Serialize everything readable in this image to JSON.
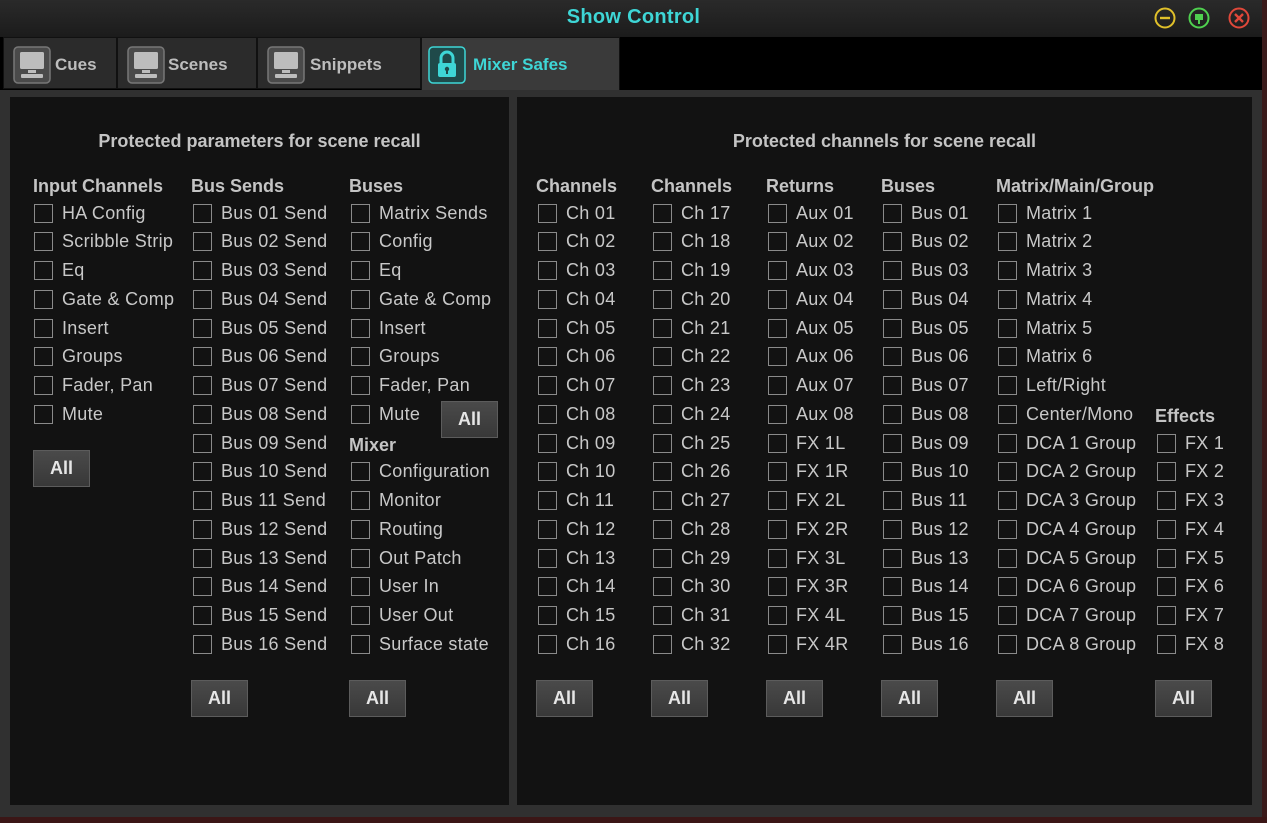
{
  "window": {
    "title": "Show Control"
  },
  "tabs": [
    {
      "label": "Cues",
      "icon": "monitor-icon"
    },
    {
      "label": "Scenes",
      "icon": "monitor-icon"
    },
    {
      "label": "Snippets",
      "icon": "monitor-icon"
    },
    {
      "label": "Mixer Safes",
      "icon": "lock-icon"
    }
  ],
  "accent_color": "#3ed6d6",
  "left_panel": {
    "title": "Protected parameters for scene recall",
    "input_channels": {
      "heading": "Input Channels",
      "items": [
        "HA Config",
        "Scribble Strip",
        "Eq",
        "Gate & Comp",
        "Insert",
        "Groups",
        "Fader, Pan",
        "Mute"
      ],
      "all_label": "All"
    },
    "bus_sends": {
      "heading": "Bus Sends",
      "items": [
        "Bus 01 Send",
        "Bus 02 Send",
        "Bus 03 Send",
        "Bus 04 Send",
        "Bus 05 Send",
        "Bus 06 Send",
        "Bus 07 Send",
        "Bus 08 Send",
        "Bus 09 Send",
        "Bus 10 Send",
        "Bus 11 Send",
        "Bus 12 Send",
        "Bus 13 Send",
        "Bus 14 Send",
        "Bus 15 Send",
        "Bus 16 Send"
      ],
      "all_label": "All"
    },
    "buses": {
      "heading": "Buses",
      "items": [
        "Matrix Sends",
        "Config",
        "Eq",
        "Gate & Comp",
        "Insert",
        "Groups",
        "Fader, Pan",
        "Mute"
      ],
      "all_label": "All"
    },
    "mixer": {
      "heading": "Mixer",
      "items": [
        "Configuration",
        "Monitor",
        "Routing",
        "Out Patch",
        "User In",
        "User Out",
        "Surface state"
      ],
      "all_label": "All"
    }
  },
  "right_panel": {
    "title": "Protected channels for scene recall",
    "channels_a": {
      "heading": "Channels",
      "items": [
        "Ch 01",
        "Ch 02",
        "Ch 03",
        "Ch 04",
        "Ch 05",
        "Ch 06",
        "Ch 07",
        "Ch 08",
        "Ch 09",
        "Ch 10",
        "Ch 11",
        "Ch 12",
        "Ch 13",
        "Ch 14",
        "Ch 15",
        "Ch 16"
      ],
      "all_label": "All"
    },
    "channels_b": {
      "heading": "Channels",
      "items": [
        "Ch 17",
        "Ch 18",
        "Ch 19",
        "Ch 20",
        "Ch 21",
        "Ch 22",
        "Ch 23",
        "Ch 24",
        "Ch 25",
        "Ch 26",
        "Ch 27",
        "Ch 28",
        "Ch 29",
        "Ch 30",
        "Ch 31",
        "Ch 32"
      ],
      "all_label": "All"
    },
    "returns": {
      "heading": "Returns",
      "items": [
        "Aux 01",
        "Aux 02",
        "Aux 03",
        "Aux 04",
        "Aux 05",
        "Aux 06",
        "Aux 07",
        "Aux 08",
        "FX 1L",
        "FX 1R",
        "FX 2L",
        "FX 2R",
        "FX 3L",
        "FX 3R",
        "FX 4L",
        "FX 4R"
      ],
      "all_label": "All"
    },
    "buses": {
      "heading": "Buses",
      "items": [
        "Bus 01",
        "Bus 02",
        "Bus 03",
        "Bus 04",
        "Bus 05",
        "Bus 06",
        "Bus 07",
        "Bus 08",
        "Bus 09",
        "Bus 10",
        "Bus 11",
        "Bus 12",
        "Bus 13",
        "Bus 14",
        "Bus 15",
        "Bus 16"
      ],
      "all_label": "All"
    },
    "matrix_main_group": {
      "heading": "Matrix/Main/Group",
      "items": [
        "Matrix 1",
        "Matrix 2",
        "Matrix 3",
        "Matrix 4",
        "Matrix 5",
        "Matrix 6",
        "Left/Right",
        "Center/Mono",
        "DCA 1 Group",
        "DCA 2 Group",
        "DCA 3 Group",
        "DCA 4 Group",
        "DCA 5 Group",
        "DCA 6 Group",
        "DCA 7 Group",
        "DCA 8 Group"
      ],
      "all_label": "All"
    },
    "effects": {
      "heading": "Effects",
      "items": [
        "FX 1",
        "FX 2",
        "FX 3",
        "FX 4",
        "FX 5",
        "FX 6",
        "FX 7",
        "FX 8"
      ],
      "all_label": "All"
    }
  }
}
